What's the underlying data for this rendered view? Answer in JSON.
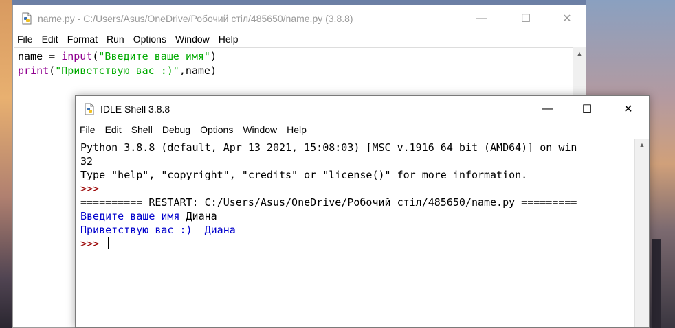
{
  "editor": {
    "title": "name.py - C:/Users/Asus/OneDrive/Робочий стіл/485650/name.py (3.8.8)",
    "menu": [
      "File",
      "Edit",
      "Format",
      "Run",
      "Options",
      "Window",
      "Help"
    ],
    "code": {
      "line1": {
        "a": "name = ",
        "b": "input",
        "c": "(",
        "d": "\"Введите ваше имя\"",
        "e": ")"
      },
      "line2": {
        "a": "print",
        "b": "(",
        "c": "\"Приветствую вас :)\"",
        "d": ",name)"
      }
    }
  },
  "shell": {
    "title": "IDLE Shell 3.8.8",
    "menu": [
      "File",
      "Edit",
      "Shell",
      "Debug",
      "Options",
      "Window",
      "Help"
    ],
    "lines": {
      "banner1": "Python 3.8.8 (default, Apr 13 2021, 15:08:03) [MSC v.1916 64 bit (AMD64)] on win",
      "banner2": "32",
      "banner3": "Type \"help\", \"copyright\", \"credits\" or \"license()\" for more information.",
      "prompt1": ">>> ",
      "restart": "========== RESTART: C:/Users/Asus/OneDrive/Робочий стіл/485650/name.py =========",
      "input_prompt": "Введите ваше имя ",
      "input_value": "Диана",
      "output": "Приветствую вас :)  Диана",
      "prompt2": ">>> "
    }
  },
  "window_controls": {
    "minimize": "—",
    "maximize": "☐",
    "close": "✕"
  },
  "colors": {
    "keyword": "#900090",
    "string": "#00aa00",
    "prompt": "#990000",
    "stdout": "#0000cc"
  },
  "icons": {
    "app": "python-idle-icon"
  }
}
